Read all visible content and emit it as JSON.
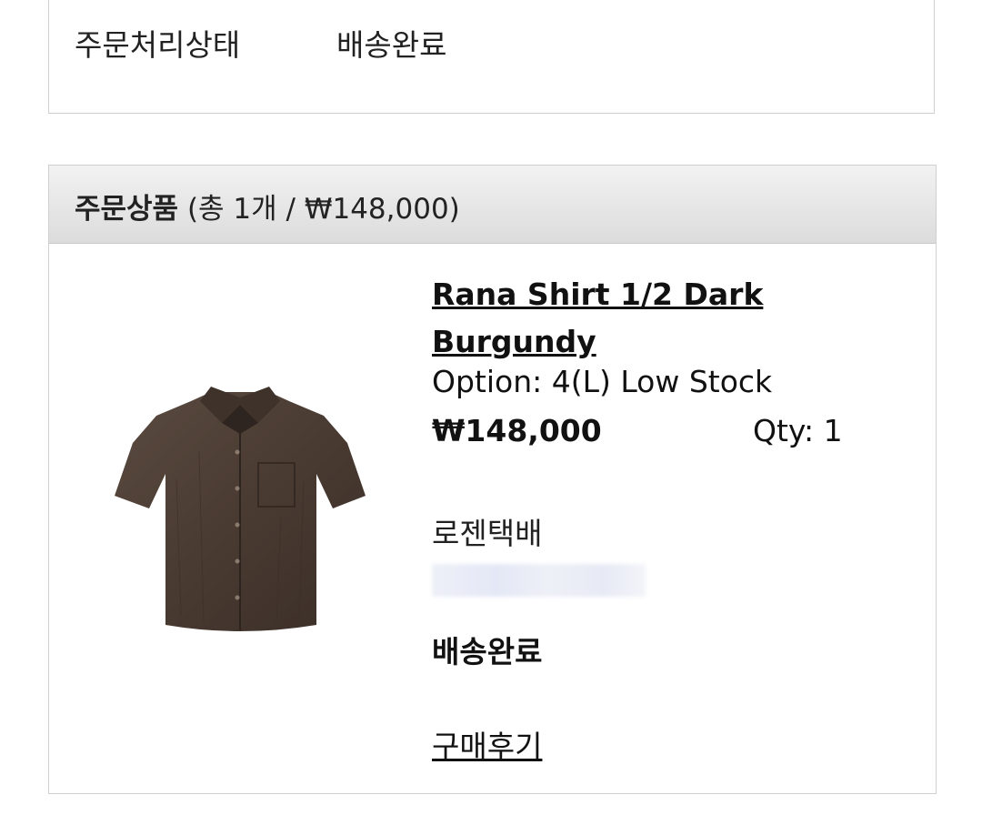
{
  "order_status": {
    "label": "주문처리상태",
    "value": "배송완료"
  },
  "order_products": {
    "title": "주문상품",
    "summary": "(총 1개 / ₩148,000)",
    "item": {
      "name": "Rana Shirt 1/2 Dark Burgundy",
      "option": "Option: 4(L) Low Stock",
      "price": "₩148,000",
      "quantity": "Qty: 1",
      "courier": "로젠택배",
      "delivery_status": "배송완료",
      "review_link": "구매후기",
      "image_color": "#4a3b32"
    }
  }
}
